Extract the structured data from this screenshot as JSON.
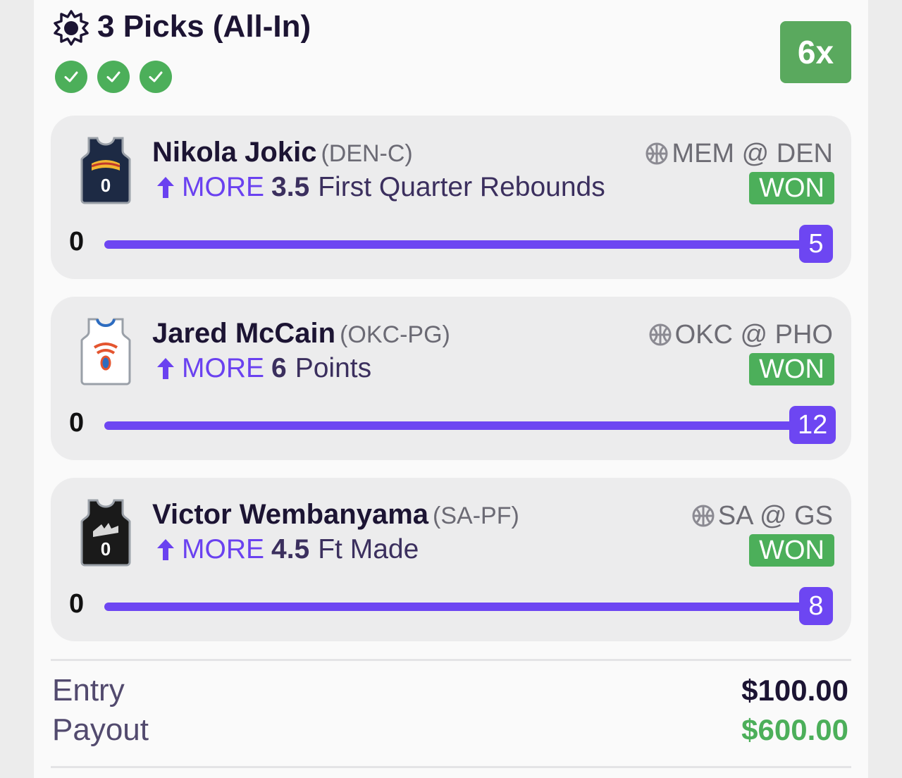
{
  "header": {
    "title": "3 Picks (All-In)",
    "multiplier": "6x",
    "icon": "gear-sun-icon",
    "checks": [
      "check-icon",
      "check-icon",
      "check-icon"
    ]
  },
  "picks": [
    {
      "player": "Nikola Jokic",
      "position": "(DEN-C)",
      "direction": "MORE",
      "line": "3.5",
      "stat_type": "First Quarter Rebounds",
      "game": "MEM @ DEN",
      "status": "WON",
      "min_label": "0",
      "current": "5",
      "progress": 1.0,
      "jersey_number": "0"
    },
    {
      "player": "Jared McCain",
      "position": "(OKC-PG)",
      "direction": "MORE",
      "line": "6",
      "stat_type": "Points",
      "game": "OKC @ PHO",
      "status": "WON",
      "min_label": "0",
      "current": "12",
      "progress": 1.0,
      "jersey_number": ""
    },
    {
      "player": "Victor Wembanyama",
      "position": "(SA-PF)",
      "direction": "MORE",
      "line": "4.5",
      "stat_type": "Ft Made",
      "game": "SA @ GS",
      "status": "WON",
      "min_label": "0",
      "current": "8",
      "progress": 1.0,
      "jersey_number": "0"
    }
  ],
  "footer": {
    "entry_label": "Entry",
    "entry_value": "$100.00",
    "payout_label": "Payout",
    "payout_value": "$600.00"
  },
  "colors": {
    "accent_purple": "#6d46f2",
    "won_green": "#4caf5a",
    "payout_green": "#4caf5a"
  }
}
